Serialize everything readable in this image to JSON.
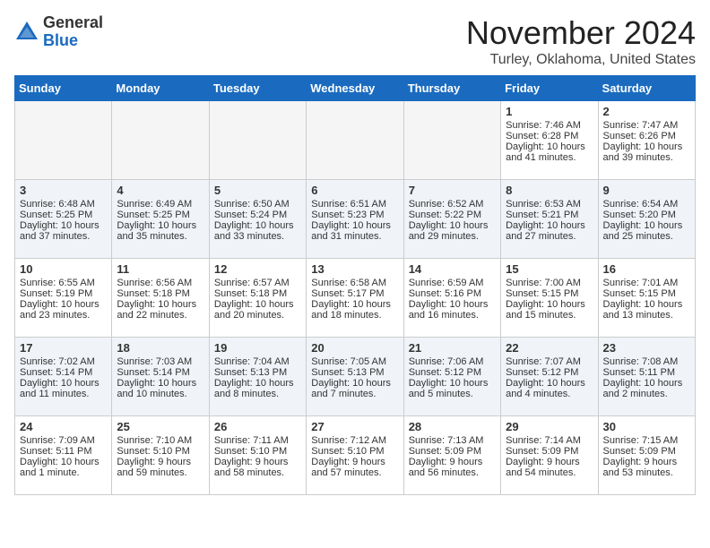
{
  "header": {
    "logo_general": "General",
    "logo_blue": "Blue",
    "month_title": "November 2024",
    "location": "Turley, Oklahoma, United States"
  },
  "weekdays": [
    "Sunday",
    "Monday",
    "Tuesday",
    "Wednesday",
    "Thursday",
    "Friday",
    "Saturday"
  ],
  "weeks": [
    [
      {
        "day": "",
        "empty": true
      },
      {
        "day": "",
        "empty": true
      },
      {
        "day": "",
        "empty": true
      },
      {
        "day": "",
        "empty": true
      },
      {
        "day": "",
        "empty": true
      },
      {
        "day": "1",
        "sunrise": "Sunrise: 7:46 AM",
        "sunset": "Sunset: 6:28 PM",
        "daylight": "Daylight: 10 hours and 41 minutes."
      },
      {
        "day": "2",
        "sunrise": "Sunrise: 7:47 AM",
        "sunset": "Sunset: 6:26 PM",
        "daylight": "Daylight: 10 hours and 39 minutes."
      }
    ],
    [
      {
        "day": "3",
        "sunrise": "Sunrise: 6:48 AM",
        "sunset": "Sunset: 5:25 PM",
        "daylight": "Daylight: 10 hours and 37 minutes."
      },
      {
        "day": "4",
        "sunrise": "Sunrise: 6:49 AM",
        "sunset": "Sunset: 5:25 PM",
        "daylight": "Daylight: 10 hours and 35 minutes."
      },
      {
        "day": "5",
        "sunrise": "Sunrise: 6:50 AM",
        "sunset": "Sunset: 5:24 PM",
        "daylight": "Daylight: 10 hours and 33 minutes."
      },
      {
        "day": "6",
        "sunrise": "Sunrise: 6:51 AM",
        "sunset": "Sunset: 5:23 PM",
        "daylight": "Daylight: 10 hours and 31 minutes."
      },
      {
        "day": "7",
        "sunrise": "Sunrise: 6:52 AM",
        "sunset": "Sunset: 5:22 PM",
        "daylight": "Daylight: 10 hours and 29 minutes."
      },
      {
        "day": "8",
        "sunrise": "Sunrise: 6:53 AM",
        "sunset": "Sunset: 5:21 PM",
        "daylight": "Daylight: 10 hours and 27 minutes."
      },
      {
        "day": "9",
        "sunrise": "Sunrise: 6:54 AM",
        "sunset": "Sunset: 5:20 PM",
        "daylight": "Daylight: 10 hours and 25 minutes."
      }
    ],
    [
      {
        "day": "10",
        "sunrise": "Sunrise: 6:55 AM",
        "sunset": "Sunset: 5:19 PM",
        "daylight": "Daylight: 10 hours and 23 minutes."
      },
      {
        "day": "11",
        "sunrise": "Sunrise: 6:56 AM",
        "sunset": "Sunset: 5:18 PM",
        "daylight": "Daylight: 10 hours and 22 minutes."
      },
      {
        "day": "12",
        "sunrise": "Sunrise: 6:57 AM",
        "sunset": "Sunset: 5:18 PM",
        "daylight": "Daylight: 10 hours and 20 minutes."
      },
      {
        "day": "13",
        "sunrise": "Sunrise: 6:58 AM",
        "sunset": "Sunset: 5:17 PM",
        "daylight": "Daylight: 10 hours and 18 minutes."
      },
      {
        "day": "14",
        "sunrise": "Sunrise: 6:59 AM",
        "sunset": "Sunset: 5:16 PM",
        "daylight": "Daylight: 10 hours and 16 minutes."
      },
      {
        "day": "15",
        "sunrise": "Sunrise: 7:00 AM",
        "sunset": "Sunset: 5:15 PM",
        "daylight": "Daylight: 10 hours and 15 minutes."
      },
      {
        "day": "16",
        "sunrise": "Sunrise: 7:01 AM",
        "sunset": "Sunset: 5:15 PM",
        "daylight": "Daylight: 10 hours and 13 minutes."
      }
    ],
    [
      {
        "day": "17",
        "sunrise": "Sunrise: 7:02 AM",
        "sunset": "Sunset: 5:14 PM",
        "daylight": "Daylight: 10 hours and 11 minutes."
      },
      {
        "day": "18",
        "sunrise": "Sunrise: 7:03 AM",
        "sunset": "Sunset: 5:14 PM",
        "daylight": "Daylight: 10 hours and 10 minutes."
      },
      {
        "day": "19",
        "sunrise": "Sunrise: 7:04 AM",
        "sunset": "Sunset: 5:13 PM",
        "daylight": "Daylight: 10 hours and 8 minutes."
      },
      {
        "day": "20",
        "sunrise": "Sunrise: 7:05 AM",
        "sunset": "Sunset: 5:13 PM",
        "daylight": "Daylight: 10 hours and 7 minutes."
      },
      {
        "day": "21",
        "sunrise": "Sunrise: 7:06 AM",
        "sunset": "Sunset: 5:12 PM",
        "daylight": "Daylight: 10 hours and 5 minutes."
      },
      {
        "day": "22",
        "sunrise": "Sunrise: 7:07 AM",
        "sunset": "Sunset: 5:12 PM",
        "daylight": "Daylight: 10 hours and 4 minutes."
      },
      {
        "day": "23",
        "sunrise": "Sunrise: 7:08 AM",
        "sunset": "Sunset: 5:11 PM",
        "daylight": "Daylight: 10 hours and 2 minutes."
      }
    ],
    [
      {
        "day": "24",
        "sunrise": "Sunrise: 7:09 AM",
        "sunset": "Sunset: 5:11 PM",
        "daylight": "Daylight: 10 hours and 1 minute."
      },
      {
        "day": "25",
        "sunrise": "Sunrise: 7:10 AM",
        "sunset": "Sunset: 5:10 PM",
        "daylight": "Daylight: 9 hours and 59 minutes."
      },
      {
        "day": "26",
        "sunrise": "Sunrise: 7:11 AM",
        "sunset": "Sunset: 5:10 PM",
        "daylight": "Daylight: 9 hours and 58 minutes."
      },
      {
        "day": "27",
        "sunrise": "Sunrise: 7:12 AM",
        "sunset": "Sunset: 5:10 PM",
        "daylight": "Daylight: 9 hours and 57 minutes."
      },
      {
        "day": "28",
        "sunrise": "Sunrise: 7:13 AM",
        "sunset": "Sunset: 5:09 PM",
        "daylight": "Daylight: 9 hours and 56 minutes."
      },
      {
        "day": "29",
        "sunrise": "Sunrise: 7:14 AM",
        "sunset": "Sunset: 5:09 PM",
        "daylight": "Daylight: 9 hours and 54 minutes."
      },
      {
        "day": "30",
        "sunrise": "Sunrise: 7:15 AM",
        "sunset": "Sunset: 5:09 PM",
        "daylight": "Daylight: 9 hours and 53 minutes."
      }
    ]
  ]
}
